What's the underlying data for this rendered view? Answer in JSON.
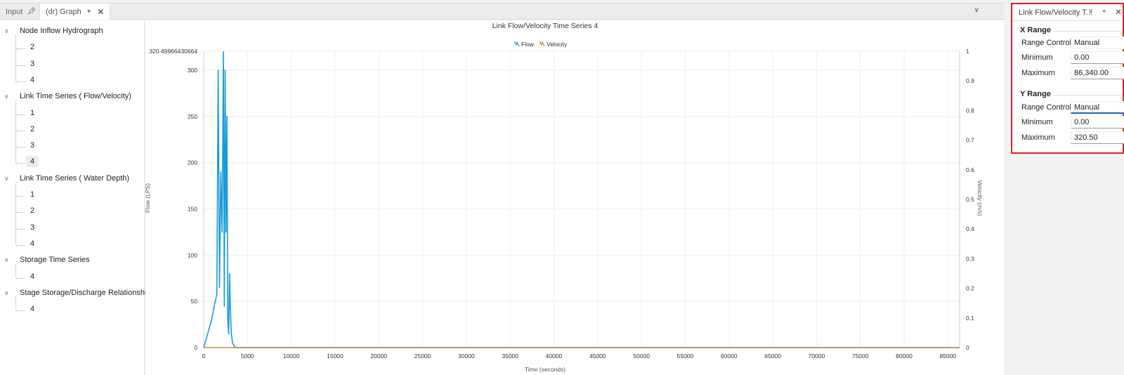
{
  "tabs": {
    "input_label": "Input",
    "graph_label": "(dr) Graph"
  },
  "tree": {
    "groups": [
      {
        "label": "Node Inflow Hydrograph",
        "items": [
          "2",
          "3",
          "4"
        ]
      },
      {
        "label": "Link Time Series ( Flow/Velocity)",
        "items": [
          "1",
          "2",
          "3",
          "4"
        ]
      },
      {
        "label": "Link Time Series ( Water Depth)",
        "items": [
          "1",
          "2",
          "3",
          "4"
        ]
      },
      {
        "label": "Storage Time Series",
        "items": [
          "4"
        ]
      },
      {
        "label": "Stage Storage/Discharge Relationship",
        "items": [
          "4"
        ]
      }
    ],
    "selected": "Link Time Series ( Flow/Velocity) / 4"
  },
  "panel": {
    "title": "Link Flow/Velocity T...",
    "x_range": {
      "heading": "X Range",
      "range_control_label": "Range Control",
      "range_control_value": "Manual",
      "minimum_label": "Minimum",
      "minimum_value": "0.00",
      "maximum_label": "Maximum",
      "maximum_value": "86,340.00"
    },
    "y_range": {
      "heading": "Y Range",
      "range_control_label": "Range Control",
      "range_control_value": "Manual",
      "minimum_label": "Minimum",
      "minimum_value": "0.00",
      "maximum_label": "Maximum",
      "maximum_value": "320.50"
    }
  },
  "colors": {
    "flow": "#1a9bd7",
    "velocity": "#c8782a",
    "panel_border": "#e01f1f"
  },
  "chart_data": {
    "type": "line",
    "title": "Link Flow/Velocity Time Series 4",
    "xlabel": "Time (seconds)",
    "ylabel": "Flow (LPS)",
    "y2label": "Velocity (m/s)",
    "xlim": [
      0,
      86340
    ],
    "ylim": [
      0,
      320.49966430664
    ],
    "y2lim": [
      0,
      1
    ],
    "y_max_label": "320.49966430664",
    "x_ticks": [
      "0",
      "5000",
      "10000",
      "15000",
      "20000",
      "25000",
      "30000",
      "35000",
      "40000",
      "45000",
      "50000",
      "55000",
      "60000",
      "65000",
      "70000",
      "75000",
      "80000",
      "85000"
    ],
    "y_ticks": [
      "0",
      "50",
      "100",
      "150",
      "200",
      "250",
      "300"
    ],
    "y2_ticks": [
      "0",
      "0.1",
      "0.2",
      "0.3",
      "0.4",
      "0.5",
      "0.6",
      "0.7",
      "0.8",
      "0.9",
      "1"
    ],
    "grid": true,
    "legend_position": "top-center",
    "series": [
      {
        "name": "Flow",
        "axis": "left",
        "x": [
          0,
          300,
          600,
          900,
          1200,
          1500,
          1650,
          1800,
          1950,
          2100,
          2250,
          2350,
          2450,
          2550,
          2650,
          2750,
          2850,
          2950,
          3050,
          3150,
          3300,
          3500,
          3800,
          4200,
          86340
        ],
        "y": [
          0,
          10,
          20,
          30,
          45,
          58,
          300,
          65,
          190,
          125,
          320,
          45,
          300,
          125,
          250,
          30,
          15,
          80,
          40,
          15,
          5,
          1,
          0,
          0,
          0
        ]
      },
      {
        "name": "Velocity",
        "axis": "right",
        "x": [
          0,
          86340
        ],
        "y": [
          0,
          0
        ]
      }
    ]
  }
}
